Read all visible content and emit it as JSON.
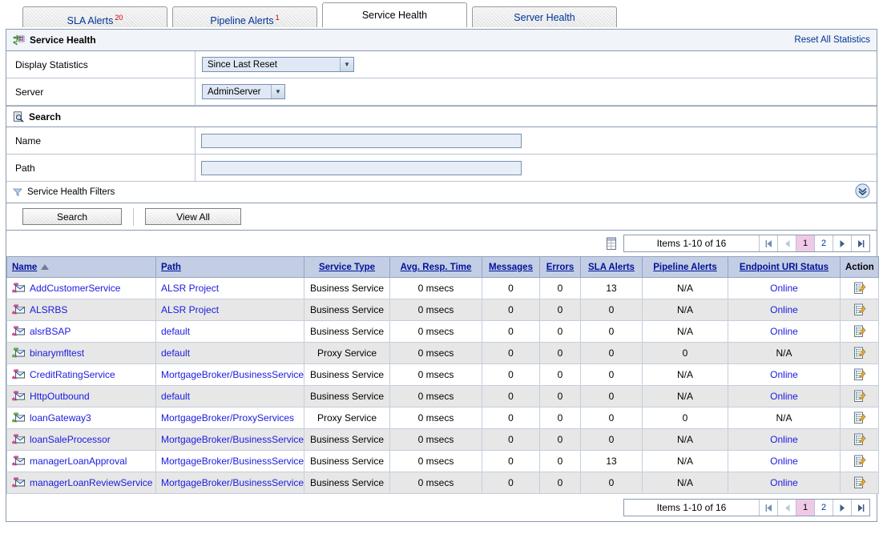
{
  "tabs": [
    {
      "label": "SLA Alerts",
      "badge": "20",
      "active": false
    },
    {
      "label": "Pipeline Alerts",
      "badge": "1",
      "active": false
    },
    {
      "label": "Service Health",
      "badge": "",
      "active": true
    },
    {
      "label": "Server Health",
      "badge": "",
      "active": false
    }
  ],
  "header": {
    "title": "Service Health",
    "reset_link": "Reset All Statistics"
  },
  "form": {
    "display_statistics_label": "Display Statistics",
    "display_statistics_value": "Since Last Reset",
    "server_label": "Server",
    "server_value": "AdminServer"
  },
  "search": {
    "title": "Search",
    "name_label": "Name",
    "name_value": "",
    "name_placeholder": "",
    "path_label": "Path",
    "path_value": "",
    "path_placeholder": "",
    "filters_label": "Service Health Filters",
    "search_button": "Search",
    "view_all_button": "View All"
  },
  "pagination": {
    "items_text": "Items 1-10 of 16",
    "first": "|◀",
    "prev": "◀",
    "pages": [
      "1",
      "2"
    ],
    "current_page": "1",
    "next": "▶",
    "last": "▶|"
  },
  "table": {
    "columns": [
      {
        "label": "Name",
        "sortable": true,
        "align": "left",
        "sorted": "asc"
      },
      {
        "label": "Path",
        "sortable": true,
        "align": "left"
      },
      {
        "label": "Service Type",
        "sortable": true,
        "align": "center"
      },
      {
        "label": "Avg. Resp. Time",
        "sortable": true,
        "align": "center"
      },
      {
        "label": "Messages",
        "sortable": true,
        "align": "center"
      },
      {
        "label": "Errors",
        "sortable": true,
        "align": "center"
      },
      {
        "label": "SLA Alerts",
        "sortable": true,
        "align": "center"
      },
      {
        "label": "Pipeline Alerts",
        "sortable": true,
        "align": "center"
      },
      {
        "label": "Endpoint URI Status",
        "sortable": true,
        "align": "center"
      },
      {
        "label": "Action",
        "sortable": false,
        "align": "center"
      }
    ],
    "rows": [
      {
        "name": "AddCustomerService",
        "icon": "business-service-icon",
        "path": "ALSR Project",
        "service_type": "Business Service",
        "avg_resp_time": "0 msecs",
        "messages": "0",
        "errors": "0",
        "sla_alerts": "13",
        "pipeline_alerts": "N/A",
        "endpoint_uri_status": "Online",
        "endpoint_is_link": true,
        "action": "view-statistics-icon"
      },
      {
        "name": "ALSRBS",
        "icon": "business-service-icon",
        "path": "ALSR Project",
        "service_type": "Business Service",
        "avg_resp_time": "0 msecs",
        "messages": "0",
        "errors": "0",
        "sla_alerts": "0",
        "pipeline_alerts": "N/A",
        "endpoint_uri_status": "Online",
        "endpoint_is_link": true,
        "action": "view-statistics-icon"
      },
      {
        "name": "alsrBSAP",
        "icon": "business-service-icon",
        "path": "default",
        "service_type": "Business Service",
        "avg_resp_time": "0 msecs",
        "messages": "0",
        "errors": "0",
        "sla_alerts": "0",
        "pipeline_alerts": "N/A",
        "endpoint_uri_status": "Online",
        "endpoint_is_link": true,
        "action": "view-statistics-icon"
      },
      {
        "name": "binarymfltest",
        "icon": "proxy-service-icon",
        "path": "default",
        "service_type": "Proxy Service",
        "avg_resp_time": "0 msecs",
        "messages": "0",
        "errors": "0",
        "sla_alerts": "0",
        "pipeline_alerts": "0",
        "endpoint_uri_status": "N/A",
        "endpoint_is_link": false,
        "action": "view-statistics-icon"
      },
      {
        "name": "CreditRatingService",
        "icon": "business-service-icon",
        "path": "MortgageBroker/BusinessServices",
        "service_type": "Business Service",
        "avg_resp_time": "0 msecs",
        "messages": "0",
        "errors": "0",
        "sla_alerts": "0",
        "pipeline_alerts": "N/A",
        "endpoint_uri_status": "Online",
        "endpoint_is_link": true,
        "action": "view-statistics-icon"
      },
      {
        "name": "HttpOutbound",
        "icon": "business-service-icon",
        "path": "default",
        "service_type": "Business Service",
        "avg_resp_time": "0 msecs",
        "messages": "0",
        "errors": "0",
        "sla_alerts": "0",
        "pipeline_alerts": "N/A",
        "endpoint_uri_status": "Online",
        "endpoint_is_link": true,
        "action": "view-statistics-icon"
      },
      {
        "name": "loanGateway3",
        "icon": "proxy-service-icon",
        "path": "MortgageBroker/ProxyServices",
        "service_type": "Proxy Service",
        "avg_resp_time": "0 msecs",
        "messages": "0",
        "errors": "0",
        "sla_alerts": "0",
        "pipeline_alerts": "0",
        "endpoint_uri_status": "N/A",
        "endpoint_is_link": false,
        "action": "view-statistics-icon"
      },
      {
        "name": "loanSaleProcessor",
        "icon": "business-service-icon",
        "path": "MortgageBroker/BusinessServices",
        "service_type": "Business Service",
        "avg_resp_time": "0 msecs",
        "messages": "0",
        "errors": "0",
        "sla_alerts": "0",
        "pipeline_alerts": "N/A",
        "endpoint_uri_status": "Online",
        "endpoint_is_link": true,
        "action": "view-statistics-icon"
      },
      {
        "name": "managerLoanApproval",
        "icon": "business-service-icon",
        "path": "MortgageBroker/BusinessService",
        "service_type": "Business Service",
        "avg_resp_time": "0 msecs",
        "messages": "0",
        "errors": "0",
        "sla_alerts": "13",
        "pipeline_alerts": "N/A",
        "endpoint_uri_status": "Online",
        "endpoint_is_link": true,
        "action": "view-statistics-icon"
      },
      {
        "name": "managerLoanReviewService",
        "icon": "business-service-icon",
        "path": "MortgageBroker/BusinessServices",
        "service_type": "Business Service",
        "avg_resp_time": "0 msecs",
        "messages": "0",
        "errors": "0",
        "sla_alerts": "0",
        "pipeline_alerts": "N/A",
        "endpoint_uri_status": "Online",
        "endpoint_is_link": true,
        "action": "view-statistics-icon"
      }
    ]
  },
  "colors": {
    "link": "#1a1ae0",
    "header_link": "#00119a",
    "tab_link": "#00349a",
    "badge": "#cc0000",
    "table_header_bg": "#c3cee4",
    "row_alt_bg": "#e7e7e7",
    "current_page_bg": "#f0c8e8"
  }
}
